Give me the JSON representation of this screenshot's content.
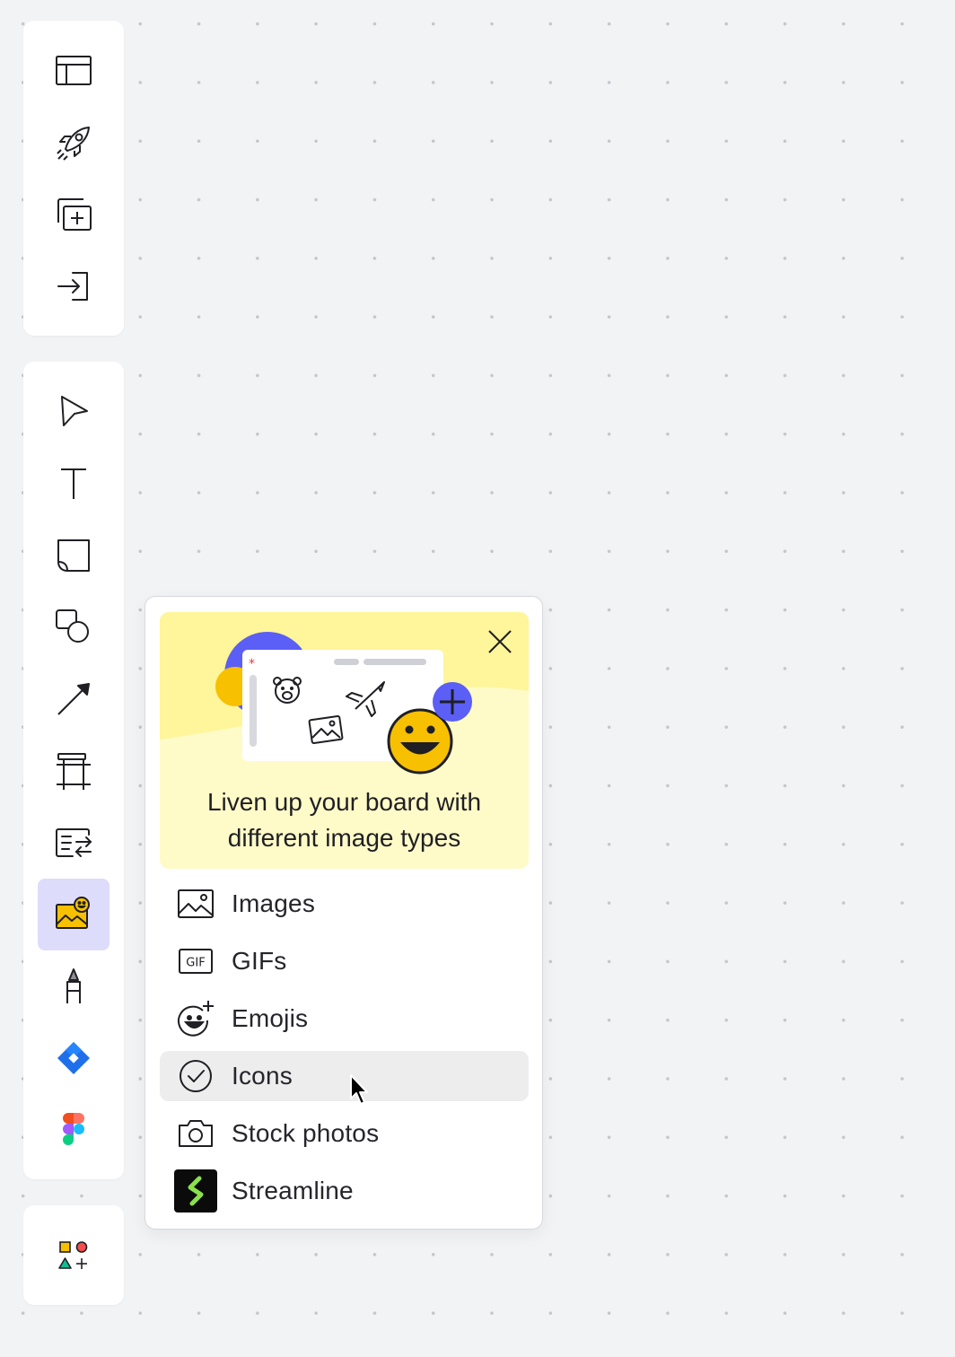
{
  "toolbar_top": {
    "items": [
      {
        "icon": "frame-layout-icon"
      },
      {
        "icon": "rocket-icon"
      },
      {
        "icon": "add-board-icon"
      },
      {
        "icon": "import-icon"
      }
    ]
  },
  "toolbar_main": {
    "items": [
      {
        "icon": "select-cursor-icon"
      },
      {
        "icon": "text-icon",
        "glyph": "T"
      },
      {
        "icon": "sticky-note-icon"
      },
      {
        "icon": "shapes-icon"
      },
      {
        "icon": "arrow-line-icon"
      },
      {
        "icon": "frame-icon"
      },
      {
        "icon": "card-swap-icon"
      },
      {
        "icon": "image-emoji-icon",
        "active": true
      },
      {
        "icon": "marker-pen-icon"
      },
      {
        "icon": "jira-icon"
      },
      {
        "icon": "figma-icon"
      }
    ]
  },
  "toolbar_bottom": {
    "items": [
      {
        "icon": "more-apps-icon"
      }
    ]
  },
  "popover": {
    "banner_text_line1": "Liven up your board with",
    "banner_text_line2": "different image types",
    "close_icon": "close-icon",
    "items": [
      {
        "label": "Images",
        "icon": "image-icon"
      },
      {
        "label": "GIFs",
        "icon": "gif-icon",
        "badge": "GIF"
      },
      {
        "label": "Emojis",
        "icon": "emoji-add-icon"
      },
      {
        "label": "Icons",
        "icon": "check-circle-icon",
        "hovered": true
      },
      {
        "label": "Stock photos",
        "icon": "camera-icon"
      },
      {
        "label": "Streamline",
        "icon": "streamline-logo-icon"
      }
    ]
  },
  "colors": {
    "canvas": "#f2f3f5",
    "active_tool_bg": "#dedcfb",
    "banner_yellow": "#fff7a0",
    "banner_light": "#fffbc8",
    "accent_purple": "#5b5ff5",
    "emoji_yellow": "#f7c000",
    "streamline_green": "#8be04e",
    "hover_bg": "#ededee"
  }
}
